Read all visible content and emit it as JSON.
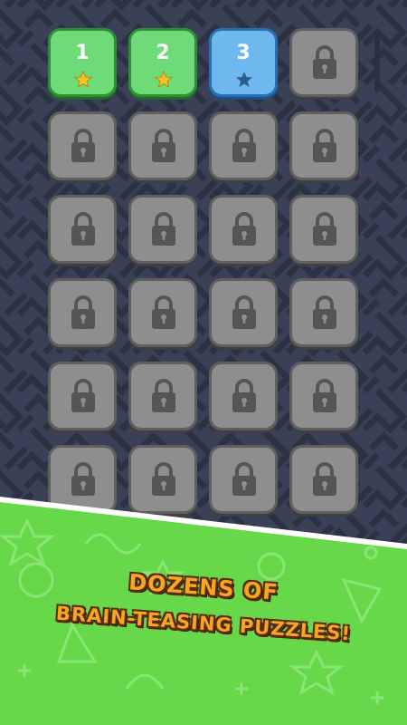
{
  "levels": [
    {
      "number": "1",
      "state": "completed",
      "stars": 1
    },
    {
      "number": "2",
      "state": "completed",
      "stars": 1
    },
    {
      "number": "3",
      "state": "current",
      "stars": 0
    },
    {
      "state": "locked"
    },
    {
      "state": "locked"
    },
    {
      "state": "locked"
    },
    {
      "state": "locked"
    },
    {
      "state": "locked"
    },
    {
      "state": "locked"
    },
    {
      "state": "locked"
    },
    {
      "state": "locked"
    },
    {
      "state": "locked"
    },
    {
      "state": "locked"
    },
    {
      "state": "locked"
    },
    {
      "state": "locked"
    },
    {
      "state": "locked"
    },
    {
      "state": "locked"
    },
    {
      "state": "locked"
    },
    {
      "state": "locked"
    },
    {
      "state": "locked"
    },
    {
      "state": "locked"
    },
    {
      "state": "locked"
    },
    {
      "state": "locked"
    },
    {
      "state": "locked"
    }
  ],
  "banner": {
    "line1": "Dozens of",
    "line2": "Brain-Teasing Puzzles!"
  },
  "colors": {
    "background": "#3a4157",
    "maze_line": "#2c3244",
    "completed": "#6fdb78",
    "current": "#6fb8ef",
    "locked": "#8e8e8e",
    "banner_green": "#66d84a",
    "caption_fill": "#f5a623",
    "star_gold": "#f7c325",
    "star_dark": "#2d5e88"
  },
  "icons": {
    "locked": "lock-icon",
    "earned_star": "star-icon"
  }
}
